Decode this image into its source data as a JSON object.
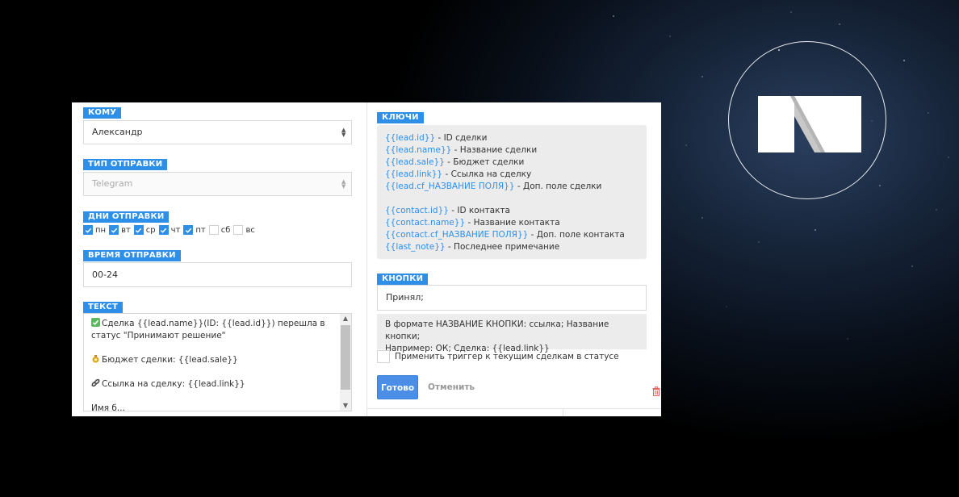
{
  "left": {
    "recipient": {
      "label": "КОМУ",
      "value": "Александр"
    },
    "send_type": {
      "label": "ТИП ОТПРАВКИ",
      "value": "Telegram"
    },
    "days": {
      "label": "ДНИ ОТПРАВКИ",
      "items": [
        {
          "label": "пн",
          "checked": true
        },
        {
          "label": "вт",
          "checked": true
        },
        {
          "label": "ср",
          "checked": true
        },
        {
          "label": "чт",
          "checked": true
        },
        {
          "label": "пт",
          "checked": true
        },
        {
          "label": "сб",
          "checked": false
        },
        {
          "label": "вс",
          "checked": false
        }
      ]
    },
    "time": {
      "label": "ВРЕМЯ ОТПРАВКИ",
      "value": "00-24"
    },
    "text": {
      "label": "ТЕКСТ",
      "line1": "Сделка {{lead.name}}(ID: {{lead.id}}) перешла в статус \"Принимают решение\"",
      "line2": "Бюджет сделки: {{lead.sale}}",
      "line3": "Ссылка на сделку: {{lead.link}}",
      "line4": "Имя б..."
    }
  },
  "right": {
    "keys": {
      "label": "КЛЮЧИ",
      "group1": [
        {
          "key": "{{lead.id}}",
          "desc": " - ID сделки"
        },
        {
          "key": "{{lead.name}}",
          "desc": " - Название сделки"
        },
        {
          "key": "{{lead.sale}}",
          "desc": " - Бюджет сделки"
        },
        {
          "key": "{{lead.link}}",
          "desc": " - Ссылка на сделку"
        },
        {
          "key": "{{lead.cf_НАЗВАНИЕ ПОЛЯ}}",
          "desc": " - Доп. поле сделки"
        }
      ],
      "group2": [
        {
          "key": "{{contact.id}}",
          "desc": " - ID контакта"
        },
        {
          "key": "{{contact.name}}",
          "desc": " - Название контакта"
        },
        {
          "key": "{{contact.cf_НАЗВАНИЕ ПОЛЯ}}",
          "desc": " - Доп. поле контакта"
        },
        {
          "key": "{{last_note}}",
          "desc": " - Последнее примечание"
        }
      ]
    },
    "buttons": {
      "label": "КНОПКИ",
      "value": "Принял;",
      "hint_line1": "В формате НАЗВАНИЕ КНОПКИ: ссылка; Название кнопки;",
      "hint_line2": "Например: ОК; Сделка: {{lead.link}}"
    },
    "trigger_label": "Применить триггер к текущим сделкам в статусе",
    "done_label": "Готово",
    "cancel_label": "Отменить"
  },
  "colors": {
    "accent": "#2e8fe8",
    "button": "#4a8ee8",
    "trash": "#e06666"
  },
  "icons": [
    "logo-icon",
    "checkmark-emoji-icon",
    "money-bag-emoji-icon",
    "link-emoji-icon",
    "trash-icon"
  ]
}
